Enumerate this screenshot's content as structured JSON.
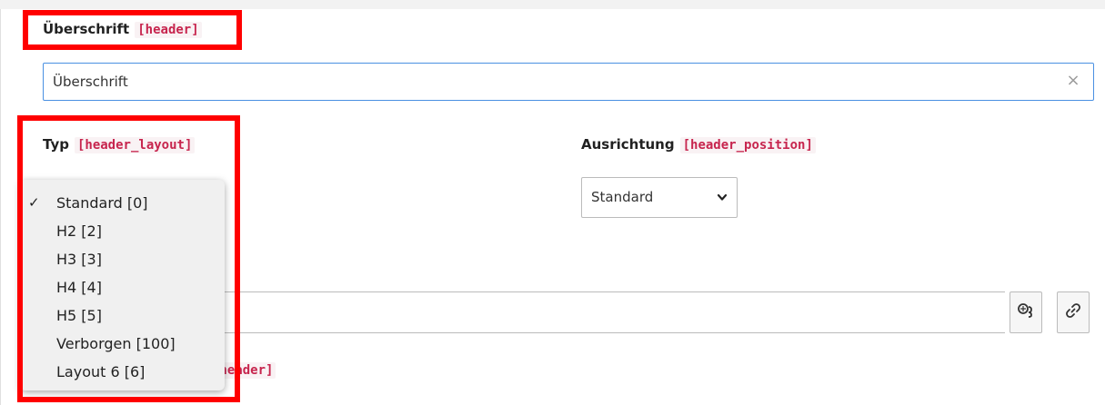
{
  "header_field": {
    "label": "Überschrift",
    "code": "[header]",
    "value": "Überschrift",
    "clear_icon": "×"
  },
  "layout_field": {
    "label": "Typ",
    "code": "[header_layout]",
    "selected_index": 0,
    "options": [
      "Standard [0]",
      "H2 [2]",
      "H3 [3]",
      "H4 [4]",
      "H5 [5]",
      "Verborgen [100]",
      "Layout 6 [6]"
    ],
    "check_mark": "✓"
  },
  "position_field": {
    "label": "Ausrichtung",
    "code": "[header_position]",
    "value": "Standard"
  },
  "link_field": {
    "value": "",
    "buttons": [
      "link-browser-icon",
      "link-icon"
    ]
  },
  "partial_label": {
    "code_fragment": "bheader]"
  },
  "colors": {
    "highlight": "#ff0000",
    "code_text": "#c7254e",
    "input_focus": "#4a90e2"
  }
}
